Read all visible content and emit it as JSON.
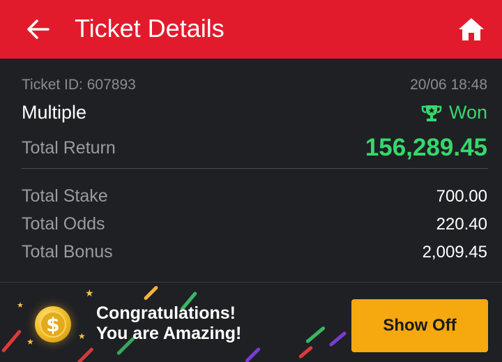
{
  "header": {
    "title": "Ticket Details",
    "back_icon": "arrow-left-icon",
    "home_icon": "home-icon",
    "background": "#e21b2c"
  },
  "ticket": {
    "id_label": "Ticket ID: 607893",
    "datetime": "20/06 18:48",
    "bet_type": "Multiple",
    "status": "Won",
    "status_icon": "trophy-icon",
    "status_color": "#35d96b",
    "total_return_label": "Total Return",
    "total_return_value": "156,289.45",
    "details": [
      {
        "label": "Total Stake",
        "value": "700.00"
      },
      {
        "label": "Total Odds",
        "value": "220.40"
      },
      {
        "label": "Total Bonus",
        "value": "2,009.45"
      }
    ]
  },
  "promo": {
    "line1": "Congratulations!",
    "line2": "You are Amazing!",
    "coin_icon": "dollar-coin-icon",
    "button_label": "Show Off",
    "button_color": "#f5a90f"
  }
}
